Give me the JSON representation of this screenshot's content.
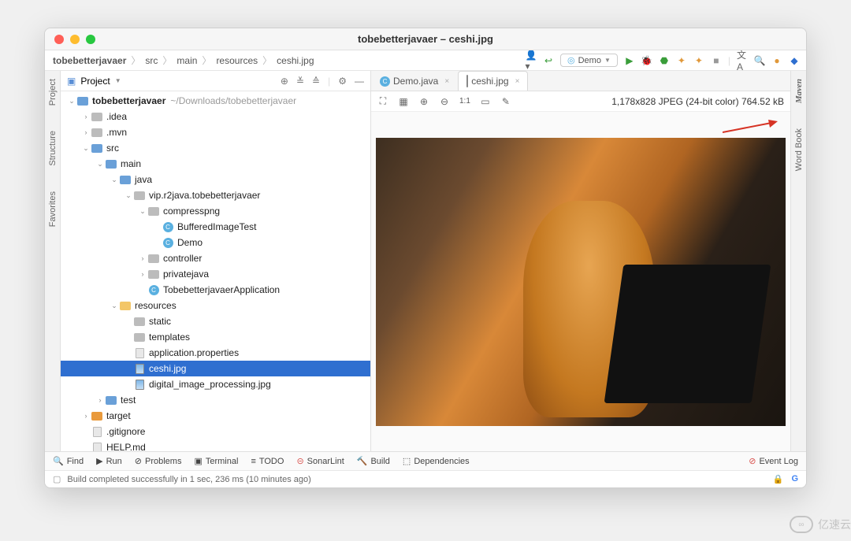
{
  "window": {
    "title": "tobebetterjavaer – ceshi.jpg"
  },
  "breadcrumbs": [
    "tobebetterjavaer",
    "src",
    "main",
    "resources",
    "ceshi.jpg"
  ],
  "runConfig": {
    "label": "Demo"
  },
  "sidebars": {
    "left": [
      "Project",
      "Structure",
      "Favorites"
    ],
    "right": [
      "Maven",
      "Word Book"
    ]
  },
  "projectPanel": {
    "title": "Project",
    "rootHint": "~/Downloads/tobebetterjavaer",
    "tree": [
      {
        "d": 0,
        "exp": true,
        "icon": "fold-b",
        "label": "tobebetterjavaer",
        "hint": "~/Downloads/tobebetterjavaer",
        "bold": true
      },
      {
        "d": 1,
        "exp": false,
        "icon": "fold-g",
        "label": ".idea",
        "chev": ">"
      },
      {
        "d": 1,
        "exp": false,
        "icon": "fold-g",
        "label": ".mvn",
        "chev": ">"
      },
      {
        "d": 1,
        "exp": true,
        "icon": "fold-b",
        "label": "src"
      },
      {
        "d": 2,
        "exp": true,
        "icon": "fold-b",
        "label": "main"
      },
      {
        "d": 3,
        "exp": true,
        "icon": "fold-b",
        "label": "java"
      },
      {
        "d": 4,
        "exp": true,
        "icon": "fold-g",
        "label": "vip.r2java.tobebetterjavaer"
      },
      {
        "d": 5,
        "exp": true,
        "icon": "fold-g",
        "label": "compresspng"
      },
      {
        "d": 6,
        "icon": "file-c",
        "label": "BufferedImageTest"
      },
      {
        "d": 6,
        "icon": "file-c",
        "label": "Demo"
      },
      {
        "d": 5,
        "exp": false,
        "icon": "fold-g",
        "label": "controller",
        "chev": ">"
      },
      {
        "d": 5,
        "exp": false,
        "icon": "fold-g",
        "label": "privatejava",
        "chev": ">"
      },
      {
        "d": 5,
        "icon": "file-c",
        "label": "TobebetterjavaerApplication"
      },
      {
        "d": 3,
        "exp": true,
        "icon": "fold-y",
        "label": "resources"
      },
      {
        "d": 4,
        "icon": "fold-g",
        "label": "static"
      },
      {
        "d": 4,
        "icon": "fold-g",
        "label": "templates"
      },
      {
        "d": 4,
        "icon": "file-p",
        "label": "application.properties"
      },
      {
        "d": 4,
        "icon": "file-img",
        "label": "ceshi.jpg",
        "sel": true
      },
      {
        "d": 4,
        "icon": "file-img",
        "label": "digital_image_processing.jpg"
      },
      {
        "d": 2,
        "exp": false,
        "icon": "fold-b",
        "label": "test",
        "chev": ">"
      },
      {
        "d": 1,
        "exp": false,
        "icon": "fold-o",
        "label": "target",
        "chev": ">"
      },
      {
        "d": 1,
        "icon": "file-p",
        "label": ".gitignore"
      },
      {
        "d": 1,
        "icon": "file-p",
        "label": "HELP.md"
      }
    ]
  },
  "editorTabs": [
    {
      "icon": "file-c",
      "label": "Demo.java",
      "active": false
    },
    {
      "icon": "file-img",
      "label": "ceshi.jpg",
      "active": true
    }
  ],
  "imageBar": {
    "tools": [
      "fullscreen-icon",
      "grid-icon",
      "zoom-in-icon",
      "zoom-out-icon",
      "1:1",
      "bg-icon",
      "color-picker-icon"
    ],
    "info": "1,178x828 JPEG (24-bit color) 764.52 kB"
  },
  "bottomTools": {
    "items": [
      {
        "icon": "🔍",
        "label": "Find"
      },
      {
        "icon": "▶",
        "label": "Run"
      },
      {
        "icon": "⊘",
        "label": "Problems"
      },
      {
        "icon": "▣",
        "label": "Terminal"
      },
      {
        "icon": "≡",
        "label": "TODO"
      },
      {
        "icon": "⊝",
        "label": "SonarLint",
        "color": "#d9534f"
      },
      {
        "icon": "🔨",
        "label": "Build"
      },
      {
        "icon": "⬚",
        "label": "Dependencies"
      }
    ],
    "eventLog": "Event Log"
  },
  "status": {
    "text": "Build completed successfully in 1 sec, 236 ms (10 minutes ago)"
  },
  "watermark": "亿速云"
}
